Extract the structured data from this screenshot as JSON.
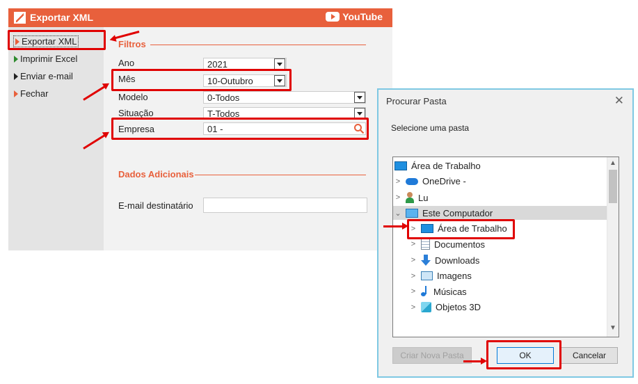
{
  "main_window": {
    "title": "Exportar XML",
    "youtube_label": "YouTube",
    "sidebar": [
      {
        "label": "Exportar XML",
        "icon": "orange-triangle-icon"
      },
      {
        "label": "Imprimir Excel",
        "icon": "green-triangle-icon"
      },
      {
        "label": "Enviar e-mail",
        "icon": "dark-triangle-icon"
      },
      {
        "label": "Fechar",
        "icon": "orange-triangle-icon"
      }
    ],
    "filtros_title": "Filtros",
    "fields": {
      "ano_label": "Ano",
      "ano_value": "2021",
      "mes_label": "Mês",
      "mes_value": "10-Outubro",
      "modelo_label": "Modelo",
      "modelo_value": "0-Todos",
      "situacao_label": "Situação",
      "situacao_value": "T-Todos",
      "empresa_label": "Empresa",
      "empresa_value": "01 -"
    },
    "dados_title": "Dados Adicionais",
    "email_label": "E-mail destinatário",
    "email_value": ""
  },
  "dialog": {
    "title": "Procurar Pasta",
    "prompt": "Selecione uma pasta",
    "tree": [
      {
        "label": "Área de Trabalho",
        "icon": "desktop-icon"
      },
      {
        "label": "OneDrive -",
        "icon": "cloud-icon"
      },
      {
        "label": "Lu",
        "icon": "user-icon"
      },
      {
        "label": "Este Computador",
        "icon": "computer-icon"
      },
      {
        "label": "Área de Trabalho",
        "icon": "desktop-icon"
      },
      {
        "label": "Documentos",
        "icon": "documents-icon"
      },
      {
        "label": "Downloads",
        "icon": "downloads-icon"
      },
      {
        "label": "Imagens",
        "icon": "pictures-icon"
      },
      {
        "label": "Músicas",
        "icon": "music-icon"
      },
      {
        "label": "Objetos 3D",
        "icon": "3d-objects-icon"
      }
    ],
    "buttons": {
      "new_folder": "Criar Nova Pasta",
      "ok": "OK",
      "cancel": "Cancelar"
    }
  },
  "colors": {
    "accent": "#e8603c",
    "highlight_box": "#e00000",
    "dialog_border": "#7ec8e3"
  }
}
